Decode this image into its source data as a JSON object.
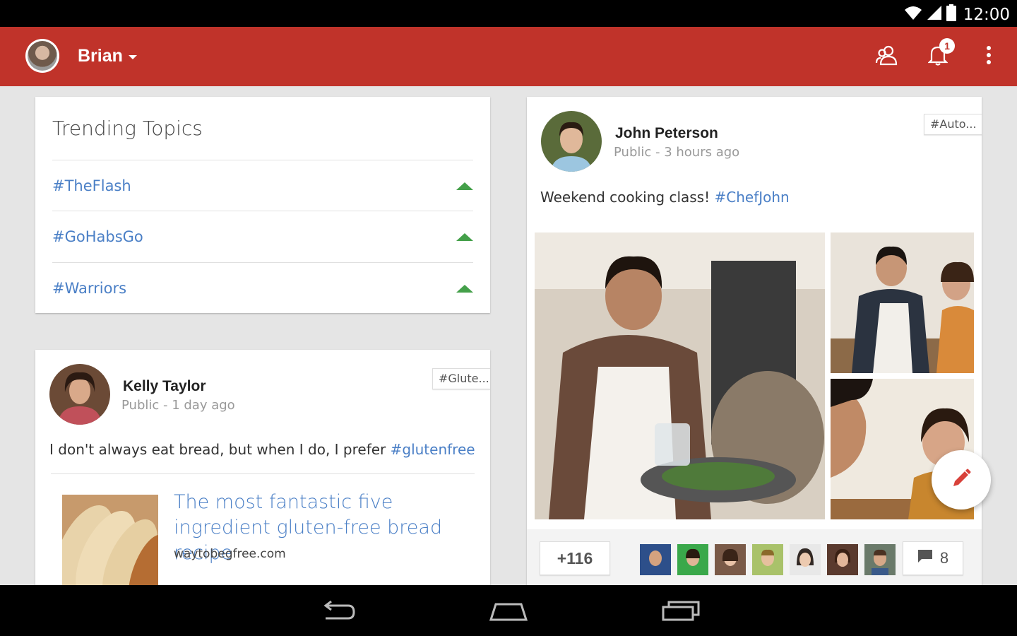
{
  "status_bar": {
    "time": "12:00"
  },
  "app_bar": {
    "account_name": "Brian",
    "notification_count": "1"
  },
  "trending": {
    "title": "Trending Topics",
    "topics": [
      {
        "tag": "#TheFlash"
      },
      {
        "tag": "#GoHabsGo"
      },
      {
        "tag": "#Warriors"
      }
    ]
  },
  "post_kelly": {
    "author": "Kelly Taylor",
    "meta": "Public - 1 day ago",
    "chip": "#Glute...",
    "text": "I don't always eat bread, but when I do, I prefer ",
    "hashtag": "#glutenfree",
    "link_title": "The most fantastic five ingredient gluten-free bread recipe",
    "link_domain": "waytobegfree.com"
  },
  "post_john": {
    "author": "John Peterson",
    "meta": "Public - 3 hours ago",
    "chip": "#Auto...",
    "text": "Weekend cooking class! ",
    "hashtag": "#ChefJohn",
    "plus_count": "+116",
    "comment_count": "8"
  },
  "icons": {
    "status": [
      "wifi-icon",
      "signal-icon",
      "battery-icon"
    ],
    "app_bar": [
      "people-icon",
      "bell-icon",
      "overflow-menu-icon"
    ],
    "nav": [
      "back-icon",
      "home-icon",
      "recents-icon"
    ],
    "fab": "pencil-icon",
    "comments": "comment-icon"
  },
  "colors": {
    "app_bar": "#c0332a",
    "link": "#4a7fc6",
    "trend_up": "#44a04a",
    "fab_icon": "#d8413a"
  }
}
